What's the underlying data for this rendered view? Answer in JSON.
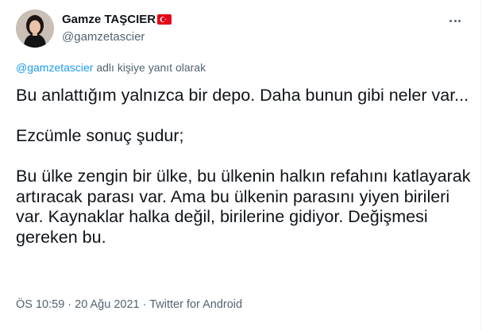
{
  "author": {
    "name": "Gamze TAŞCIER",
    "handle": "@gamzetascier",
    "verified_flag": "turkey-flag"
  },
  "reply_context": {
    "handle": "@gamzetascier",
    "suffix": " adlı kişiye yanıt olarak"
  },
  "tweet": {
    "text": "Bu anlattığım yalnızca bir depo. Daha bunun gibi neler var...\n\nEzcümle sonuç şudur;\n\nBu ülke zengin bir ülke, bu ülkenin halkın refahını katlayarak artıracak parası var. Ama bu ülkenin parasını yiyen birileri var. Kaynaklar halka değil, birilerine gidiyor. Değişmesi gereken bu."
  },
  "meta": {
    "time": "ÖS 10:59",
    "sep1": " · ",
    "date": "20 Ağu 2021",
    "sep2": " · ",
    "source": "Twitter for Android"
  },
  "colors": {
    "link": "#1d9bf0",
    "secondary": "#536471",
    "text": "#0f1419"
  }
}
